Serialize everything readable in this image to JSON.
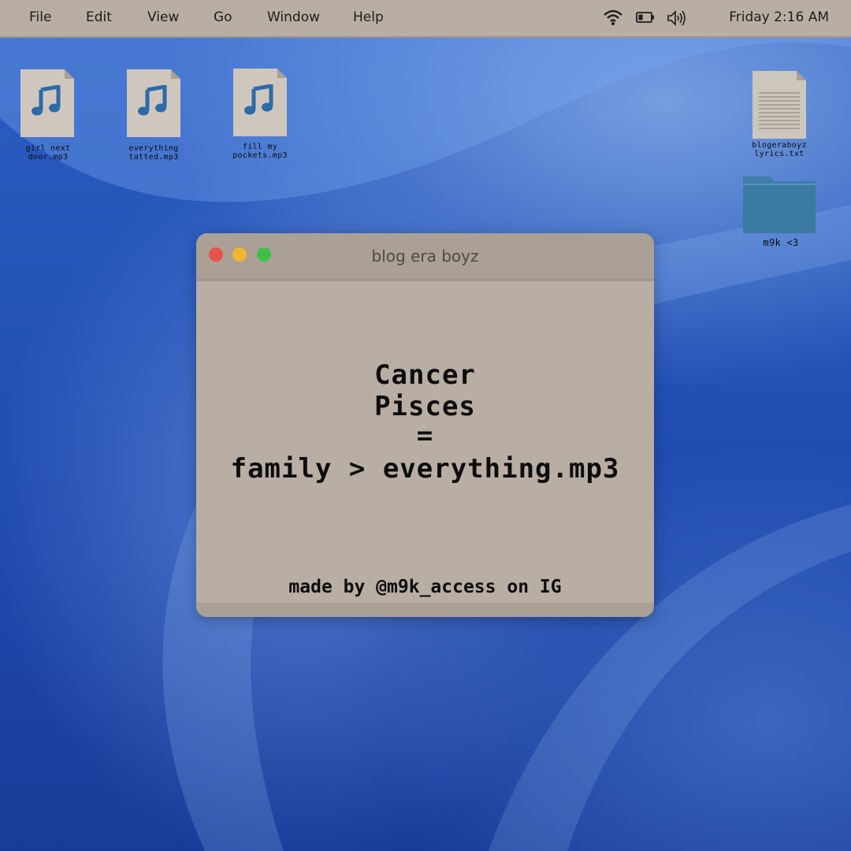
{
  "menubar": {
    "items": [
      "File",
      "Edit",
      "View",
      "Go",
      "Window",
      "Help"
    ],
    "status_icons": [
      "wifi-icon",
      "battery-icon",
      "volume-icon"
    ],
    "clock": "Friday 2:16 AM"
  },
  "desktop_icons": [
    {
      "label_line1": "girl next",
      "label_line2": "door.mp3",
      "icon": "music-note-icon"
    },
    {
      "label_line1": "everything",
      "label_line2": "tatted.mp3",
      "icon": "music-note-icon"
    },
    {
      "label_line1": "fill my",
      "label_line2": "pockets.mp3",
      "icon": "music-note-icon"
    },
    {
      "label_line1": "blogeraboyz",
      "label_line2": "lyrics.txt",
      "icon": "text-document-icon"
    },
    {
      "label_line1": "m9k <3",
      "label_line2": "",
      "icon": "folder-icon"
    }
  ],
  "window": {
    "title": "blog era boyz",
    "lines": [
      "Cancer",
      "Pisces",
      "=",
      "family > everything.mp3"
    ],
    "credit": "made by @m9k_access on IG"
  },
  "colors": {
    "window_bg": "#b9aea4",
    "titlebar_bg": "#aba096",
    "close": "#e8524a",
    "minimize": "#f2b632",
    "zoom": "#3fbf4a",
    "icon_note": "#2e6aa8",
    "folder": "#3f7ea6"
  }
}
